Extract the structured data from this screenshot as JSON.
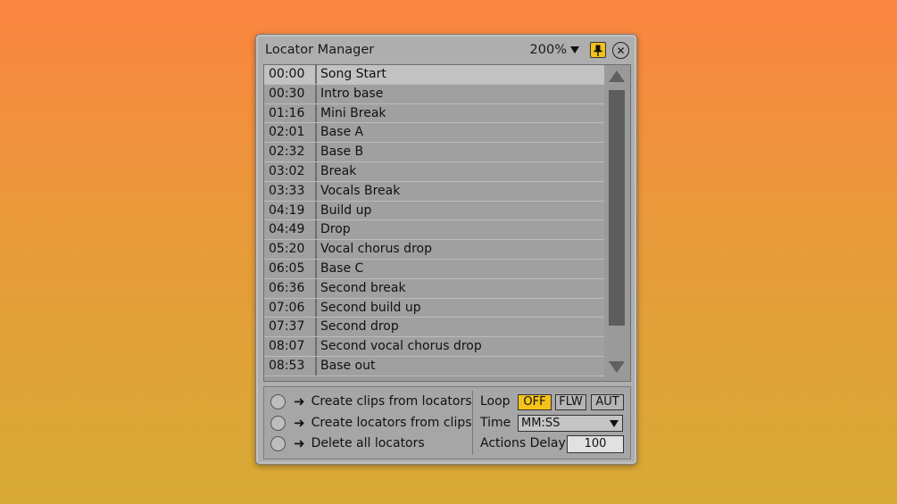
{
  "window": {
    "title": "Locator Manager",
    "zoom": "200%",
    "pin_icon": "pin-icon",
    "close_icon": "close-icon",
    "accent_color": "#f5c21a"
  },
  "locators": [
    {
      "time": "00:00",
      "name": "Song Start",
      "selected": true
    },
    {
      "time": "00:30",
      "name": "Intro base"
    },
    {
      "time": "01:16",
      "name": "Mini Break"
    },
    {
      "time": "02:01",
      "name": "Base A"
    },
    {
      "time": "02:32",
      "name": "Base B"
    },
    {
      "time": "03:02",
      "name": "Break"
    },
    {
      "time": "03:33",
      "name": "Vocals Break"
    },
    {
      "time": "04:19",
      "name": "Build up"
    },
    {
      "time": "04:49",
      "name": "Drop"
    },
    {
      "time": "05:20",
      "name": "Vocal chorus drop"
    },
    {
      "time": "06:05",
      "name": "Base C"
    },
    {
      "time": "06:36",
      "name": "Second break"
    },
    {
      "time": "07:06",
      "name": "Second build up"
    },
    {
      "time": "07:37",
      "name": "Second drop"
    },
    {
      "time": "08:07",
      "name": "Second vocal chorus drop"
    },
    {
      "time": "08:53",
      "name": "Base out"
    }
  ],
  "actions": [
    {
      "label": "Create clips from locators",
      "icon": "arrow-right-icon"
    },
    {
      "label": "Create locators from clips",
      "icon": "arrow-right-icon"
    },
    {
      "label": "Delete all locators",
      "icon": "arrow-right-icon"
    }
  ],
  "settings": {
    "loop_label": "Loop",
    "loop_options": [
      "OFF",
      "FLW",
      "AUT"
    ],
    "loop_selected": "OFF",
    "time_label": "Time",
    "time_value": "MM:SS",
    "delay_label": "Actions Delay",
    "delay_value": "100"
  }
}
